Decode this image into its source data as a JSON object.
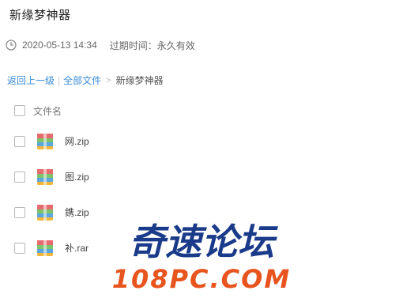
{
  "share": {
    "title": "新缘梦神器",
    "date": "2020-05-13 14:34",
    "expiry": "过期时间：永久有效",
    "icons": {
      "clock": "clock-icon"
    }
  },
  "breadcrumb": {
    "back": "返回上一级",
    "separator": "|",
    "all_files": "全部文件",
    "arrow": ">",
    "current": "新缘梦神器"
  },
  "file_list": {
    "header": "文件名",
    "files": [
      {
        "name": "网.zip",
        "icon": "archive-icon"
      },
      {
        "name": "图.zip",
        "icon": "archive-icon"
      },
      {
        "name": "鎸.zip",
        "icon": "archive-icon"
      },
      {
        "name": "补.rar",
        "icon": "archive-icon"
      }
    ]
  },
  "watermark": {
    "line1": "奇速论坛",
    "line2": "108PC.COM",
    "colors": {
      "line1": "#1a3a8a",
      "line2": "#e8541e"
    }
  }
}
